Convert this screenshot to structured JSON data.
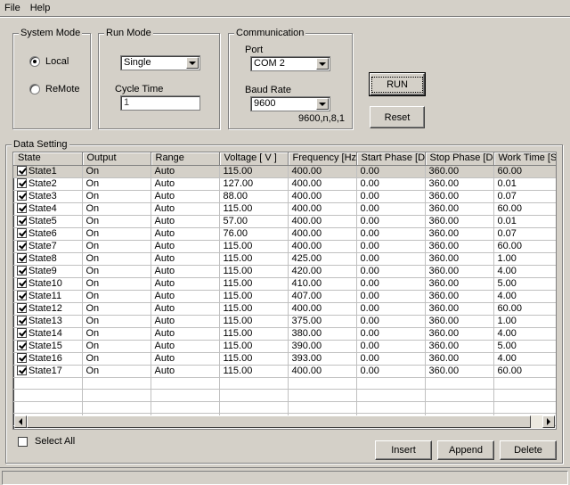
{
  "menu": {
    "file": "File",
    "help": "Help"
  },
  "system_mode": {
    "title": "System  Mode",
    "options": [
      {
        "label": "Local",
        "selected": true
      },
      {
        "label": "ReMote",
        "selected": false
      }
    ]
  },
  "run_mode": {
    "title": "Run Mode",
    "mode_value": "Single",
    "cycle_time_label": "Cycle Time",
    "cycle_time_value": "1"
  },
  "communication": {
    "title": "Communication",
    "port_label": "Port",
    "port_value": "COM 2",
    "baud_label": "Baud Rate",
    "baud_value": "9600",
    "settings_text": "9600,n,8,1"
  },
  "buttons": {
    "run": "RUN",
    "reset": "Reset",
    "insert": "Insert",
    "append": "Append",
    "delete": "Delete"
  },
  "data_setting": {
    "title": "Data Setting",
    "columns": [
      "State",
      "Output",
      "Range",
      "Voltage [ V ]",
      "Frequency [Hz]",
      "Start Phase [Deg]",
      "Stop Phase [Deg]",
      "Work Time [Sec]"
    ],
    "rows": [
      {
        "state": "State1",
        "output": "On",
        "range": "Auto",
        "voltage": "115.00",
        "frequency": "400.00",
        "start": "0.00",
        "stop": "360.00",
        "time": "60.00"
      },
      {
        "state": "State2",
        "output": "On",
        "range": "Auto",
        "voltage": "127.00",
        "frequency": "400.00",
        "start": "0.00",
        "stop": "360.00",
        "time": "0.01"
      },
      {
        "state": "State3",
        "output": "On",
        "range": "Auto",
        "voltage": "88.00",
        "frequency": "400.00",
        "start": "0.00",
        "stop": "360.00",
        "time": "0.07"
      },
      {
        "state": "State4",
        "output": "On",
        "range": "Auto",
        "voltage": "115.00",
        "frequency": "400.00",
        "start": "0.00",
        "stop": "360.00",
        "time": "60.00"
      },
      {
        "state": "State5",
        "output": "On",
        "range": "Auto",
        "voltage": "57.00",
        "frequency": "400.00",
        "start": "0.00",
        "stop": "360.00",
        "time": "0.01"
      },
      {
        "state": "State6",
        "output": "On",
        "range": "Auto",
        "voltage": "76.00",
        "frequency": "400.00",
        "start": "0.00",
        "stop": "360.00",
        "time": "0.07"
      },
      {
        "state": "State7",
        "output": "On",
        "range": "Auto",
        "voltage": "115.00",
        "frequency": "400.00",
        "start": "0.00",
        "stop": "360.00",
        "time": "60.00"
      },
      {
        "state": "State8",
        "output": "On",
        "range": "Auto",
        "voltage": "115.00",
        "frequency": "425.00",
        "start": "0.00",
        "stop": "360.00",
        "time": "1.00"
      },
      {
        "state": "State9",
        "output": "On",
        "range": "Auto",
        "voltage": "115.00",
        "frequency": "420.00",
        "start": "0.00",
        "stop": "360.00",
        "time": "4.00"
      },
      {
        "state": "State10",
        "output": "On",
        "range": "Auto",
        "voltage": "115.00",
        "frequency": "410.00",
        "start": "0.00",
        "stop": "360.00",
        "time": "5.00"
      },
      {
        "state": "State11",
        "output": "On",
        "range": "Auto",
        "voltage": "115.00",
        "frequency": "407.00",
        "start": "0.00",
        "stop": "360.00",
        "time": "4.00"
      },
      {
        "state": "State12",
        "output": "On",
        "range": "Auto",
        "voltage": "115.00",
        "frequency": "400.00",
        "start": "0.00",
        "stop": "360.00",
        "time": "60.00"
      },
      {
        "state": "State13",
        "output": "On",
        "range": "Auto",
        "voltage": "115.00",
        "frequency": "375.00",
        "start": "0.00",
        "stop": "360.00",
        "time": "1.00"
      },
      {
        "state": "State14",
        "output": "On",
        "range": "Auto",
        "voltage": "115.00",
        "frequency": "380.00",
        "start": "0.00",
        "stop": "360.00",
        "time": "4.00"
      },
      {
        "state": "State15",
        "output": "On",
        "range": "Auto",
        "voltage": "115.00",
        "frequency": "390.00",
        "start": "0.00",
        "stop": "360.00",
        "time": "5.00"
      },
      {
        "state": "State16",
        "output": "On",
        "range": "Auto",
        "voltage": "115.00",
        "frequency": "393.00",
        "start": "0.00",
        "stop": "360.00",
        "time": "4.00"
      },
      {
        "state": "State17",
        "output": "On",
        "range": "Auto",
        "voltage": "115.00",
        "frequency": "400.00",
        "start": "0.00",
        "stop": "360.00",
        "time": "60.00"
      }
    ],
    "select_all_label": "Select All"
  }
}
